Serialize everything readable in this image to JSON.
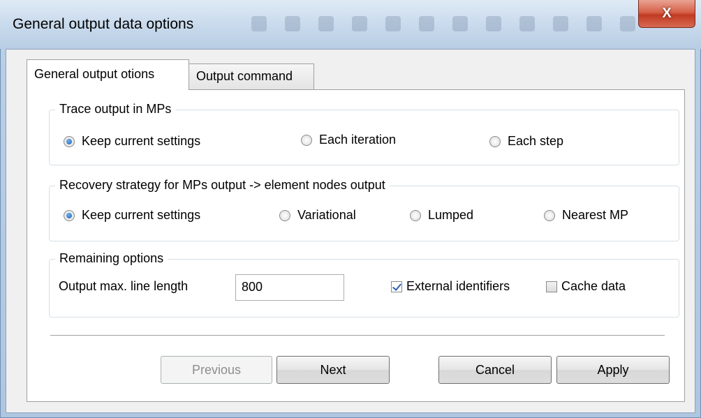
{
  "window": {
    "title": "General output data options",
    "close_label": "X"
  },
  "tabs": [
    {
      "label": "General output otions",
      "active": true
    },
    {
      "label": "Output command",
      "active": false
    }
  ],
  "trace_group": {
    "label": "Trace output in MPs",
    "options": [
      "Keep current settings",
      "Each iteration",
      "Each step"
    ],
    "selected": 0
  },
  "recovery_group": {
    "label": "Recovery strategy for MPs output -> element nodes output",
    "options": [
      "Keep current settings",
      "Variational",
      "Lumped",
      "Nearest MP"
    ],
    "selected": 0
  },
  "remaining_group": {
    "label": "Remaining options",
    "line_length_label": "Output max. line length",
    "line_length_value": "800",
    "external_identifiers_label": "External identifiers",
    "external_identifiers_checked": true,
    "cache_data_label": "Cache data",
    "cache_data_checked": false
  },
  "buttons": {
    "previous": "Previous",
    "next": "Next",
    "cancel": "Cancel",
    "apply": "Apply"
  },
  "colors": {
    "accent": "#1a5fb4",
    "close_button": "#c23a22"
  }
}
